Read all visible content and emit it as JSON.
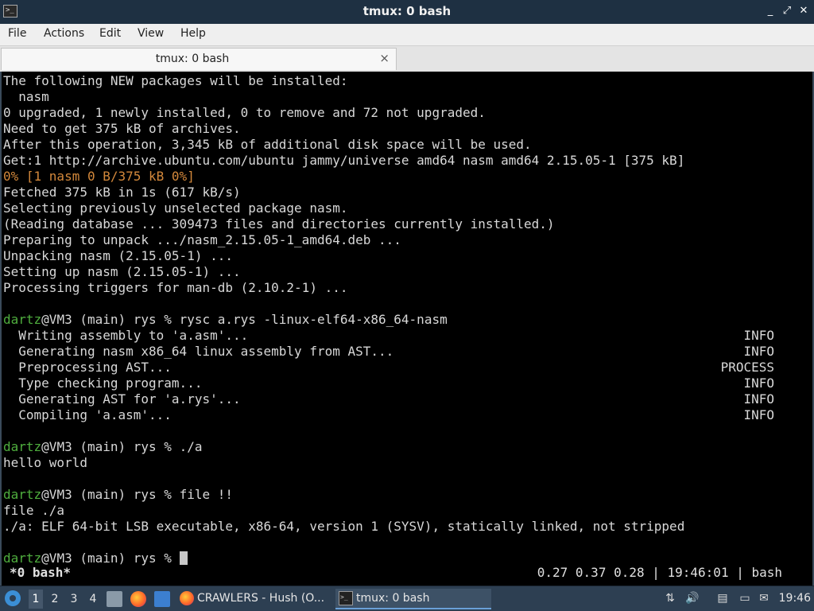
{
  "window": {
    "title": "tmux: 0 bash",
    "app_icon_glyph": ">_",
    "buttons": {
      "minimize": "_",
      "maximize": "⤢",
      "close": "✕"
    }
  },
  "menu": [
    "File",
    "Actions",
    "Edit",
    "View",
    "Help"
  ],
  "tab": {
    "label": "tmux: 0 bash",
    "close": "×"
  },
  "terminal": {
    "lines": [
      {
        "text": "The following NEW packages will be installed:"
      },
      {
        "text": "  nasm"
      },
      {
        "text": "0 upgraded, 1 newly installed, 0 to remove and 72 not upgraded."
      },
      {
        "text": "Need to get 375 kB of archives."
      },
      {
        "text": "After this operation, 3,345 kB of additional disk space will be used."
      },
      {
        "text": "Get:1 http://archive.ubuntu.com/ubuntu jammy/universe amd64 nasm amd64 2.15.05-1 [375 kB]"
      },
      {
        "text": "0% [1 nasm 0 B/375 kB 0%]",
        "style": "orange"
      },
      {
        "text": "Fetched 375 kB in 1s (617 kB/s)"
      },
      {
        "text": "Selecting previously unselected package nasm."
      },
      {
        "text": "(Reading database ... 309473 files and directories currently installed.)"
      },
      {
        "text": "Preparing to unpack .../nasm_2.15.05-1_amd64.deb ..."
      },
      {
        "text": "Unpacking nasm (2.15.05-1) ..."
      },
      {
        "text": "Setting up nasm (2.15.05-1) ..."
      },
      {
        "text": "Processing triggers for man-db (2.10.2-1) ..."
      },
      {
        "text": ""
      },
      {
        "user": "dartz",
        "text": "@VM3 (main) rys % rysc a.rys -linux-elf64-x86_64-nasm"
      },
      {
        "text": "  Writing assembly to 'a.asm'...",
        "status": "INFO"
      },
      {
        "text": "  Generating nasm x86_64 linux assembly from AST...",
        "status": "INFO"
      },
      {
        "text": "  Preprocessing AST...",
        "status": "PROCESS"
      },
      {
        "text": "  Type checking program...",
        "status": "INFO"
      },
      {
        "text": "  Generating AST for 'a.rys'...",
        "status": "INFO"
      },
      {
        "text": "  Compiling 'a.asm'...",
        "status": "INFO"
      },
      {
        "text": ""
      },
      {
        "user": "dartz",
        "text": "@VM3 (main) rys % ./a"
      },
      {
        "text": "hello world"
      },
      {
        "text": ""
      },
      {
        "user": "dartz",
        "text": "@VM3 (main) rys % file !!"
      },
      {
        "text": "file ./a"
      },
      {
        "text": "./a: ELF 64-bit LSB executable, x86-64, version 1 (SYSV), statically linked, not stripped"
      },
      {
        "text": ""
      },
      {
        "user": "dartz",
        "text": "@VM3 (main) rys % ",
        "cursor": true
      }
    ],
    "tmux_status": {
      "window": "*0 bash*",
      "right": "0.27 0.37 0.28 | 19:46:01 | bash"
    }
  },
  "taskbar": {
    "workspaces": [
      "1",
      "2",
      "3",
      "4"
    ],
    "active_workspace": "1",
    "tasks": [
      {
        "label": "CRAWLERS - Hush (O...",
        "icon": "firefox-icon"
      },
      {
        "label": "tmux: 0 bash",
        "icon": "terminal-icon"
      }
    ],
    "clock": "19:46"
  }
}
